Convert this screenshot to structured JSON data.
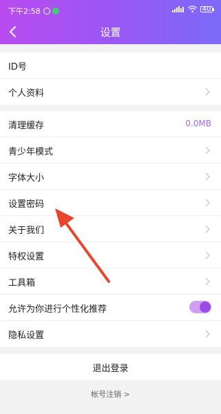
{
  "status_bar": {
    "time": "下午2:58",
    "battery": "40"
  },
  "nav": {
    "title": "设置"
  },
  "group1": [
    {
      "label": "ID号",
      "chevron": false
    },
    {
      "label": "个人资料",
      "chevron": true
    }
  ],
  "group2": [
    {
      "label": "清理缓存",
      "value": "0.0MB"
    },
    {
      "label": "青少年模式"
    },
    {
      "label": "字体大小"
    },
    {
      "label": "设置密码"
    },
    {
      "label": "关于我们"
    },
    {
      "label": "特权设置"
    },
    {
      "label": "工具箱"
    },
    {
      "label": "允许为你进行个性化推荐",
      "toggle": "on"
    },
    {
      "label": "隐私设置"
    }
  ],
  "logout_label": "退出登录",
  "cancel_account_label": "帐号注销 >",
  "colors": {
    "header_start": "#b94cf0",
    "header_end": "#7d6af8",
    "accent": "#a064f0",
    "annotation_arrow": "#e8452c"
  }
}
